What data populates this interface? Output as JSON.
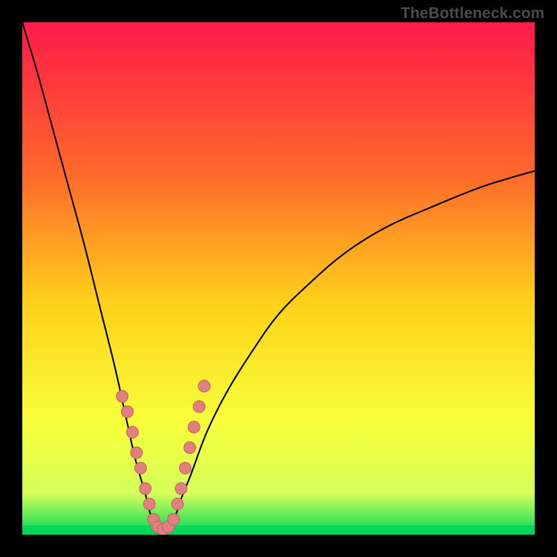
{
  "watermark": "TheBottleneck.com",
  "colors": {
    "gradient_top": "#ff1a4a",
    "gradient_mid1": "#ff6a2a",
    "gradient_mid2": "#ffd21a",
    "gradient_mid3": "#f7ff3a",
    "gradient_low": "#d4ff5a",
    "gradient_band": "#00d65a",
    "curve": "#000000",
    "marker_fill": "#e08080",
    "marker_stroke": "#c85a5a"
  },
  "chart_data": {
    "type": "line",
    "title": "",
    "xlabel": "",
    "ylabel": "",
    "xlim": [
      0,
      100
    ],
    "ylim": [
      0,
      100
    ],
    "series": [
      {
        "name": "bottleneck-curve",
        "x": [
          0,
          3,
          6,
          9,
          12,
          15,
          18,
          20,
          22,
          24,
          25,
          26,
          27,
          28,
          29,
          30,
          31,
          33,
          36,
          40,
          45,
          50,
          56,
          63,
          71,
          80,
          90,
          100
        ],
        "y": [
          100,
          90,
          79,
          68,
          57,
          45,
          33,
          24,
          15,
          8,
          4,
          2,
          1,
          1,
          2,
          4,
          7,
          12,
          20,
          28,
          36,
          43,
          49,
          55,
          60,
          64,
          68,
          71
        ]
      }
    ],
    "markers": {
      "name": "highlighted-points",
      "x": [
        19.5,
        20.5,
        21.5,
        22.3,
        23.1,
        24.0,
        24.8,
        25.6,
        26.5,
        27.5,
        28.5,
        29.5,
        30.3,
        31.0,
        31.8,
        32.7,
        33.5,
        34.5,
        35.5
      ],
      "y": [
        27,
        24,
        20,
        16,
        13,
        9,
        6,
        3,
        1.5,
        1,
        1.5,
        3,
        6,
        9,
        13,
        17,
        21,
        25,
        29
      ]
    },
    "green_band_y": 1.8
  }
}
